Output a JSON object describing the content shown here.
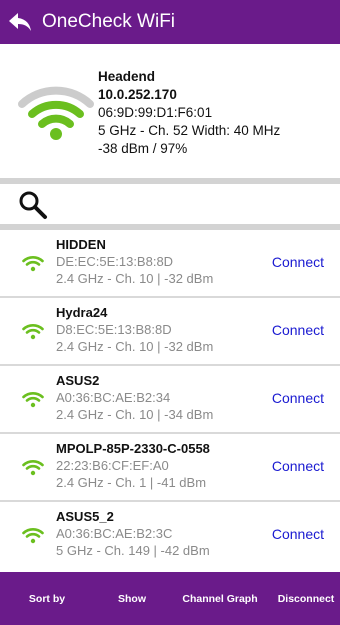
{
  "colors": {
    "accent": "#6a1b8a",
    "link": "#1a1ad1",
    "wifi_green": "#6bbf1f",
    "wifi_grey": "#cccccc"
  },
  "header": {
    "title": "OneCheck WiFi",
    "back_icon": "back-arrow-icon"
  },
  "current": {
    "name": "Headend",
    "ip": "10.0.252.170",
    "mac": "06:9D:99:D1:F6:01",
    "channel": "5 GHz - Ch. 52 Width: 40 MHz",
    "signal": "-38 dBm / 97%",
    "icon": "wifi-signal-icon"
  },
  "search": {
    "icon": "search-icon"
  },
  "networks": [
    {
      "name": "HIDDEN",
      "mac": "DE:EC:5E:13:B8:8D",
      "detail": "2.4 GHz - Ch. 10 | -32 dBm",
      "action": "Connect"
    },
    {
      "name": "Hydra24",
      "mac": "D8:EC:5E:13:B8:8D",
      "detail": "2.4 GHz - Ch. 10 | -32 dBm",
      "action": "Connect"
    },
    {
      "name": "ASUS2",
      "mac": "A0:36:BC:AE:B2:34",
      "detail": "2.4 GHz - Ch. 10 | -34 dBm",
      "action": "Connect"
    },
    {
      "name": "MPOLP-85P-2330-C-0558",
      "mac": "22:23:B6:CF:EF:A0",
      "detail": "2.4 GHz - Ch. 1 | -41 dBm",
      "action": "Connect"
    },
    {
      "name": "ASUS5_2",
      "mac": "A0:36:BC:AE:B2:3C",
      "detail": "5 GHz - Ch. 149 | -42 dBm",
      "action": "Connect"
    }
  ],
  "bottom_bar": {
    "sort_by": "Sort by",
    "show": "Show",
    "channel_graph": "Channel Graph",
    "disconnect": "Disconnect"
  }
}
